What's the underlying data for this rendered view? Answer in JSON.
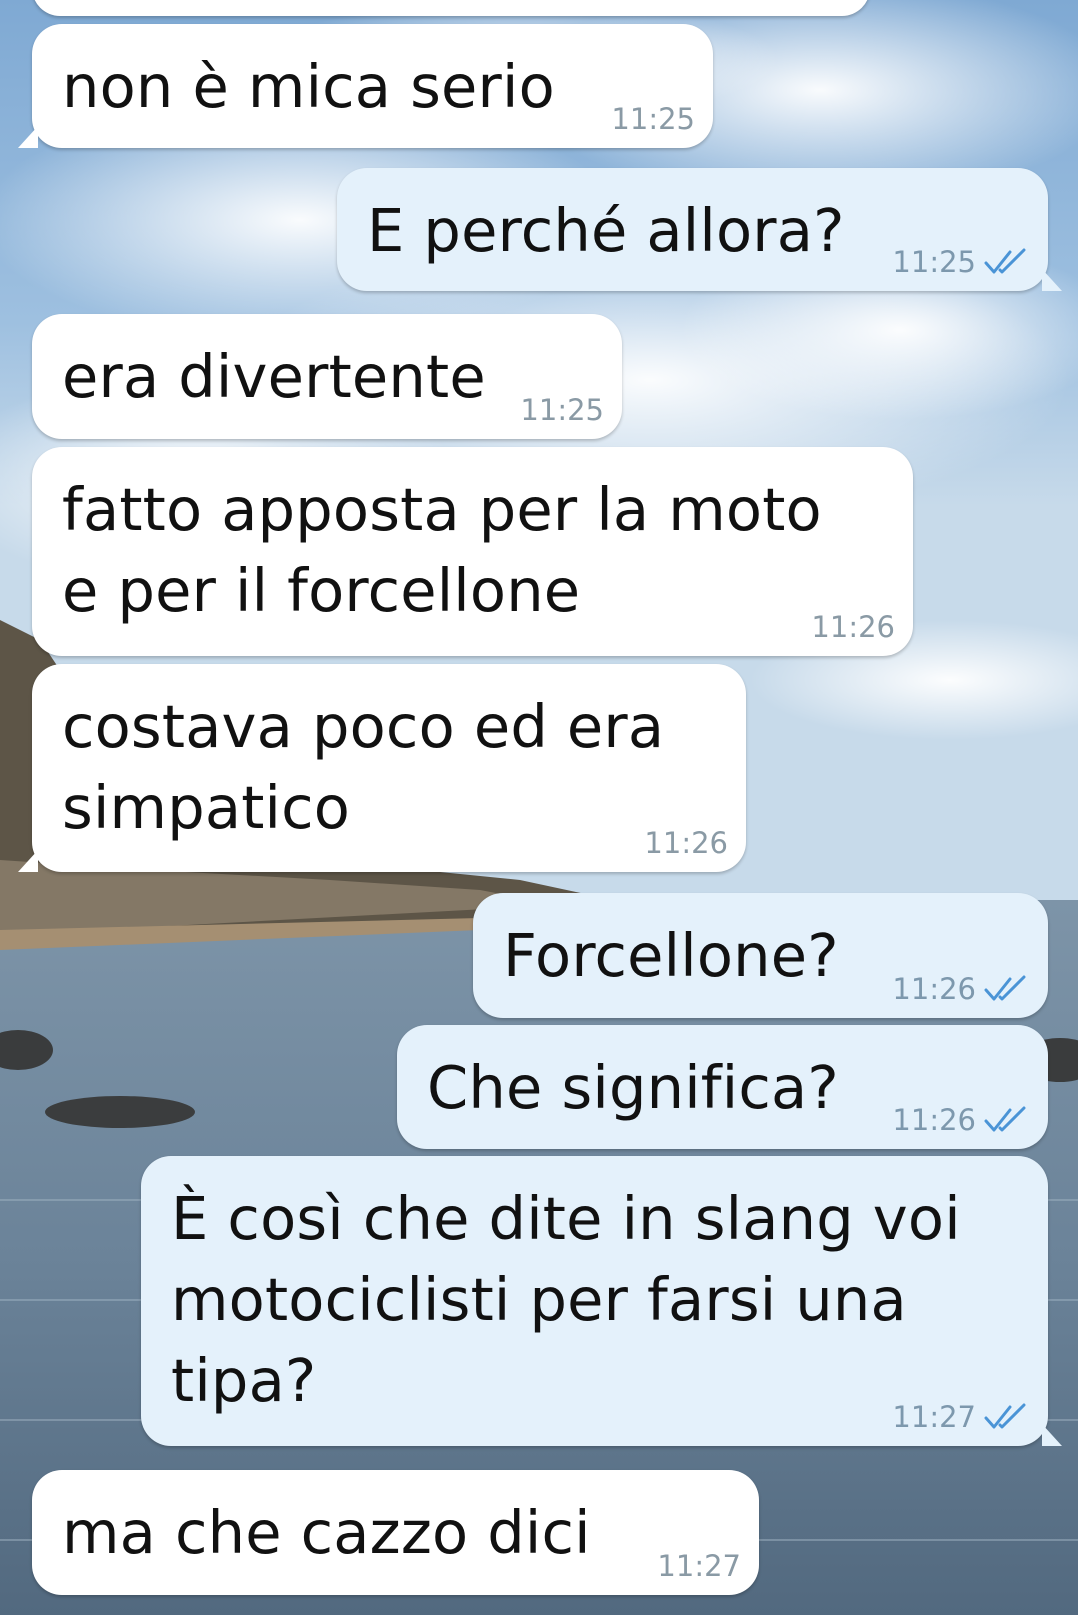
{
  "chat": {
    "messages": [
      {
        "dir": "in",
        "text": "non è mica serio",
        "time": "11:25"
      },
      {
        "dir": "out",
        "text": "E perché allora?",
        "time": "11:25"
      },
      {
        "dir": "in",
        "text": "era divertente",
        "time": "11:25"
      },
      {
        "dir": "in",
        "text": "fatto apposta per la moto\ne per il forcellone",
        "time": "11:26"
      },
      {
        "dir": "in",
        "text": "costava poco ed era\nsimpatico",
        "time": "11:26"
      },
      {
        "dir": "out",
        "text": "Forcellone?",
        "time": "11:26"
      },
      {
        "dir": "out",
        "text": "Che significa?",
        "time": "11:26"
      },
      {
        "dir": "out",
        "text": "È così che dite in slang voi\nmotociclisti per farsi una\ntipa?",
        "time": "11:27"
      },
      {
        "dir": "in",
        "text": "ma che cazzo dici",
        "time": "11:27"
      }
    ]
  },
  "colors": {
    "incoming_bubble": "#ffffff",
    "outgoing_bubble": "#e4f1fb",
    "read_ticks": "#4a94d6"
  },
  "icons": {
    "read_receipt": "double-check-icon"
  }
}
